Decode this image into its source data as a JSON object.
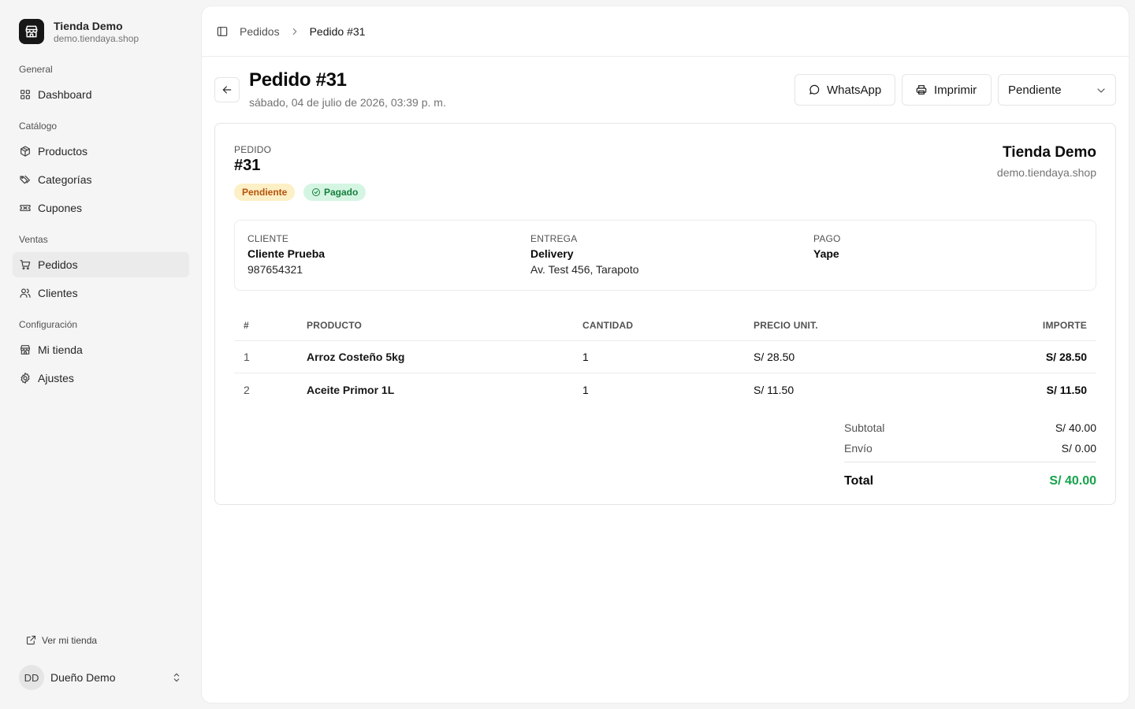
{
  "store": {
    "name": "Tienda Demo",
    "domain": "demo.tiendaya.shop"
  },
  "sidebar": {
    "groups": [
      {
        "label": "General",
        "items": [
          {
            "label": "Dashboard",
            "icon": "dashboard-icon"
          }
        ]
      },
      {
        "label": "Catálogo",
        "items": [
          {
            "label": "Productos",
            "icon": "package-icon"
          },
          {
            "label": "Categorías",
            "icon": "tags-icon"
          },
          {
            "label": "Cupones",
            "icon": "ticket-icon"
          }
        ]
      },
      {
        "label": "Ventas",
        "items": [
          {
            "label": "Pedidos",
            "icon": "cart-icon",
            "active": true
          },
          {
            "label": "Clientes",
            "icon": "users-icon"
          }
        ]
      },
      {
        "label": "Configuración",
        "items": [
          {
            "label": "Mi tienda",
            "icon": "store-icon"
          },
          {
            "label": "Ajustes",
            "icon": "gear-icon"
          }
        ]
      }
    ],
    "view_store": "Ver mi tienda",
    "user": {
      "initials": "DD",
      "name": "Dueño Demo"
    }
  },
  "breadcrumb": {
    "parent": "Pedidos",
    "current": "Pedido #31"
  },
  "header": {
    "title": "Pedido #31",
    "date": "sábado, 04 de julio de 2026, 03:39 p. m.",
    "whatsapp_label": "WhatsApp",
    "print_label": "Imprimir",
    "status_value": "Pendiente"
  },
  "order": {
    "label": "PEDIDO",
    "number": "#31",
    "status_badge": "Pendiente",
    "payment_badge": "Pagado",
    "customer": {
      "label": "CLIENTE",
      "name": "Cliente Prueba",
      "phone": "987654321"
    },
    "delivery": {
      "label": "ENTREGA",
      "method": "Delivery",
      "address": "Av. Test 456, Tarapoto"
    },
    "payment": {
      "label": "PAGO",
      "method": "Yape"
    }
  },
  "table": {
    "headers": {
      "num": "#",
      "product": "PRODUCTO",
      "qty": "CANTIDAD",
      "unit_price": "PRECIO UNIT.",
      "amount": "IMPORTE"
    },
    "rows": [
      {
        "num": "1",
        "product": "Arroz Costeño 5kg",
        "qty": "1",
        "unit_price": "S/ 28.50",
        "amount": "S/ 28.50"
      },
      {
        "num": "2",
        "product": "Aceite Primor 1L",
        "qty": "1",
        "unit_price": "S/ 11.50",
        "amount": "S/ 11.50"
      }
    ]
  },
  "totals": {
    "subtotal_label": "Subtotal",
    "subtotal": "S/ 40.00",
    "shipping_label": "Envío",
    "shipping": "S/ 0.00",
    "total_label": "Total",
    "total": "S/ 40.00"
  },
  "colors": {
    "accent_total": "#16a34a",
    "pending_bg": "#fdefc6",
    "pending_text": "#b45309",
    "paid_bg": "#d5f5e3",
    "paid_text": "#15803d"
  }
}
